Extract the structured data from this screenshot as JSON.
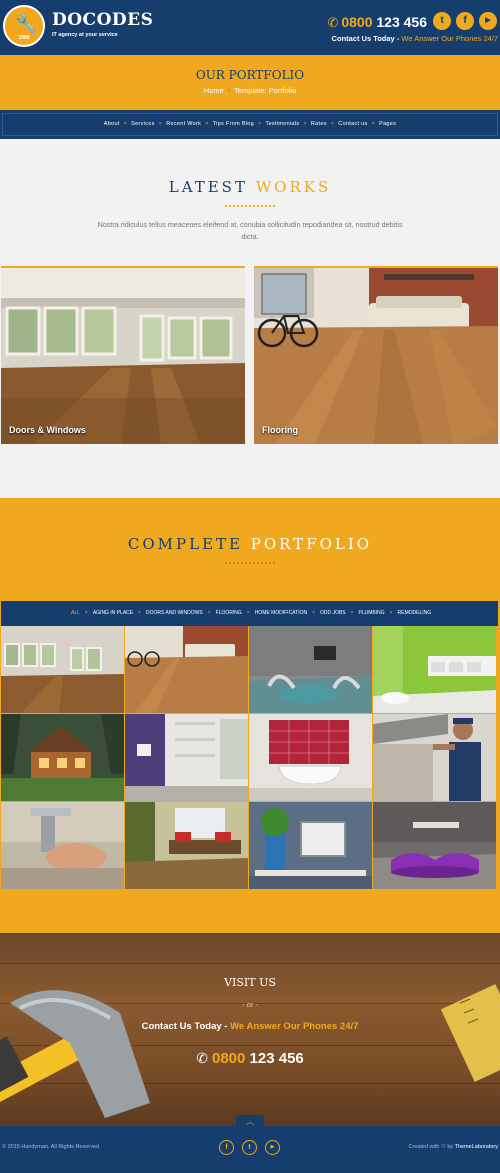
{
  "header": {
    "logo_title": "DOCODES",
    "logo_year": "1988",
    "tagline": "IT agency at your service",
    "phone_a": "0800",
    "phone_b": " 123 456",
    "contact_label": "Contact Us Today",
    "contact_dash": " - ",
    "contact_answer": "We Answer Our Phones 24/7",
    "social": [
      "twitter-icon",
      "facebook-icon",
      "youtube-icon"
    ]
  },
  "page_title": {
    "title": "OUR PORTFOLIO",
    "breadcrumb_home": "Home",
    "breadcrumb_sep": "×",
    "breadcrumb_current": "Template: Portfolio"
  },
  "nav": {
    "items": [
      "About",
      "Services",
      "Recent Work",
      "Tips From Blog",
      "Testimonials",
      "Rates",
      "Contact us",
      "Pages"
    ],
    "sep": "×"
  },
  "latest": {
    "title_a": "LATEST",
    "title_b": "WORKS",
    "description": "Nostra ridiculus tellus meacenes eleifend at, conubia sollicitudin repodiandea sit, nostrud debitis dicta.",
    "cards": [
      {
        "caption": "Doors & Windows"
      },
      {
        "caption": "Flooring"
      }
    ]
  },
  "portfolio": {
    "title_a": "COMPLETE",
    "title_b": "PORTFOLIO",
    "filters": [
      "ALL",
      "AGING IN PLACE",
      "DOORS AND WINDOWS",
      "FLOORING",
      "HOME MODIFICATION",
      "ODD JOBS",
      "PLUMBING",
      "REMODELING"
    ],
    "active_filter": "ALL",
    "sep": "×"
  },
  "visit": {
    "title": "VISIT US",
    "or": "- or -",
    "contact_label": "Contact Us Today",
    "contact_dash": " - ",
    "contact_answer": "We Answer Our Phones 24/7",
    "phone_a": "0800",
    "phone_b": " 123 456"
  },
  "footer": {
    "copyright": "© 2015 Handyman. All Rights Reserved.",
    "created_with": "Created with",
    "by": "by",
    "brand": "ThemeLaboratory",
    "social": [
      "facebook-icon",
      "twitter-icon",
      "youtube-icon"
    ]
  },
  "colors": {
    "navy": "#153e6e",
    "accent": "#f0a91e"
  }
}
